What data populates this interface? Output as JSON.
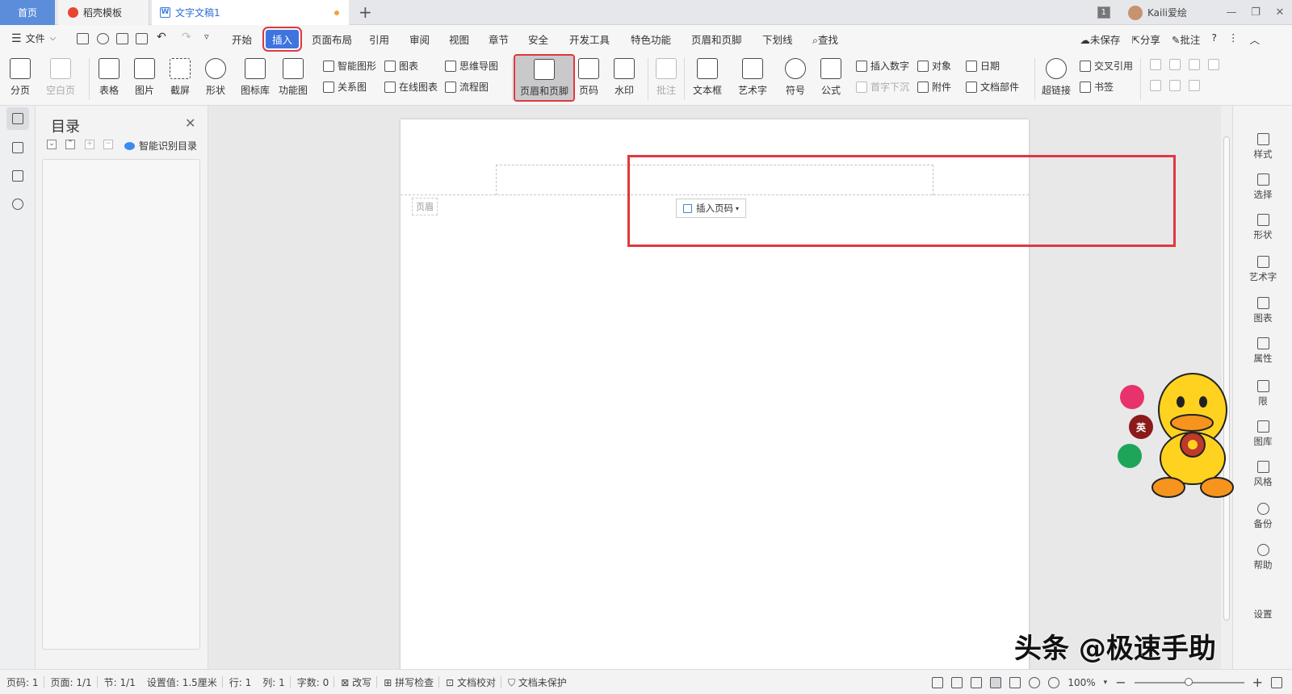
{
  "tabs": {
    "home": "首页",
    "template": "稻壳模板",
    "document": "文字文稿1",
    "add": "+"
  },
  "titlebar": {
    "page_badge": "1",
    "user": "Kaili爱绘"
  },
  "menu": {
    "file": "文件",
    "items": [
      "开始",
      "插入",
      "页面布局",
      "引用",
      "审阅",
      "视图",
      "章节",
      "安全",
      "开发工具",
      "特色功能",
      "页眉和页脚",
      "下划线",
      "查找"
    ],
    "active": "插入",
    "right": [
      "未保存",
      "分享",
      "批注",
      "?"
    ]
  },
  "ribbon": {
    "page_break": "分页",
    "blank_page": "空白页",
    "table": "表格",
    "picture": "图片",
    "screenshot": "截屏",
    "shape": "形状",
    "icon_lib": "图标库",
    "func_chart": "功能图",
    "smart_shape": "智能图形",
    "chart": "图表",
    "mindmap": "思维导图",
    "relation": "关系图",
    "online_chart": "在线图表",
    "flowchart": "流程图",
    "header_footer": "页眉和页脚",
    "page_number": "页码",
    "watermark": "水印",
    "comment": "批注",
    "textbox": "文本框",
    "wordart": "艺术字",
    "symbol": "符号",
    "formula": "公式",
    "insert_number": "插入数字",
    "object": "对象",
    "date": "日期",
    "drop_cap": "首字下沉",
    "attachment": "附件",
    "doc_parts": "文档部件",
    "hyperlink": "超链接",
    "cross_ref": "交叉引用",
    "bookmark": "书签"
  },
  "toc": {
    "title": "目录",
    "smart": "智能识别目录"
  },
  "document": {
    "header_tag": "页眉",
    "insert_page_number": "插入页码"
  },
  "right_panel": [
    "样式",
    "选择",
    "形状",
    "艺术字",
    "图表",
    "属性",
    "限",
    "图库",
    "风格",
    "备份",
    "帮助",
    "设置"
  ],
  "mascot": {
    "bubble_middle": "英"
  },
  "watermark": "头条 @极速手助",
  "status": {
    "page_no": "页码: 1",
    "pages": "页面: 1/1",
    "section": "节: 1/1",
    "setting": "设置值: 1.5厘米",
    "row": "行: 1",
    "col": "列: 1",
    "words": "字数: 0",
    "revise": "改写",
    "spell": "拼写检查",
    "proof": "文档校对",
    "protect": "文档未保护",
    "zoom": "100%"
  },
  "colors": {
    "accent": "#3d74e0",
    "highlight": "#e0383e"
  }
}
